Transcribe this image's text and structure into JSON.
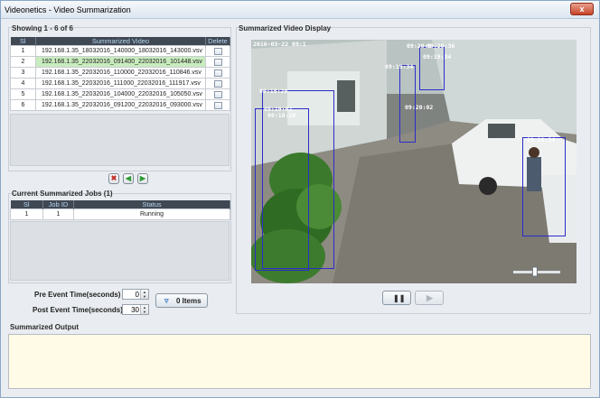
{
  "window": {
    "title": "Videonetics - Video Summarization",
    "close_glyph": "x"
  },
  "left": {
    "showing": "Showing 1 - 6 of 6",
    "table": {
      "headers": {
        "sl": "Sl",
        "video": "Summarized Video",
        "delete": "Delete"
      },
      "rows": [
        {
          "sl": "1",
          "video": "192.168.1.35_18032016_140000_18032016_143000.vsv"
        },
        {
          "sl": "2",
          "video": "192.168.1.35_22032016_091400_22032016_101448.vsv"
        },
        {
          "sl": "3",
          "video": "192.168.1.35_22032016_110000_22032016_110846.vsv"
        },
        {
          "sl": "4",
          "video": "192.168.1.35_22032016_111000_22032016_111917.vsv"
        },
        {
          "sl": "5",
          "video": "192.168.1.35_22032016_104000_22032016_105050.vsv"
        },
        {
          "sl": "6",
          "video": "192.168.1.35_22032016_091200_22032016_093000.vsv"
        }
      ]
    },
    "jobs": {
      "label": "Current Summarized Jobs (1)",
      "headers": {
        "sl": "Sl",
        "job": "Job ID",
        "status": "Status"
      },
      "rows": [
        {
          "sl": "1",
          "job": "1",
          "status": "Running"
        }
      ]
    },
    "pre_event": {
      "label": "Pre Event Time(seconds)",
      "value": "0"
    },
    "post_event": {
      "label": "Post Event Time(seconds)",
      "value": "30"
    },
    "items_button": "0 Items"
  },
  "right": {
    "label": "Summarized Video Display",
    "timestamp": "2016-03-22 09:1",
    "overlay_labels": [
      "09:20:0",
      "09:20:36",
      "09:19:34",
      "09:19:34",
      "09:18:20",
      "09:19:02",
      "09:20:02",
      "09:18:20",
      "09:19:34"
    ],
    "seek_level": 0.45
  },
  "output": {
    "label": "Summarized Output",
    "text": ""
  },
  "colors": {
    "selected_row": "#c9ecbe",
    "header": "#3f4853",
    "box": "#2c2cc8",
    "output_bg": "#fffbe6"
  }
}
